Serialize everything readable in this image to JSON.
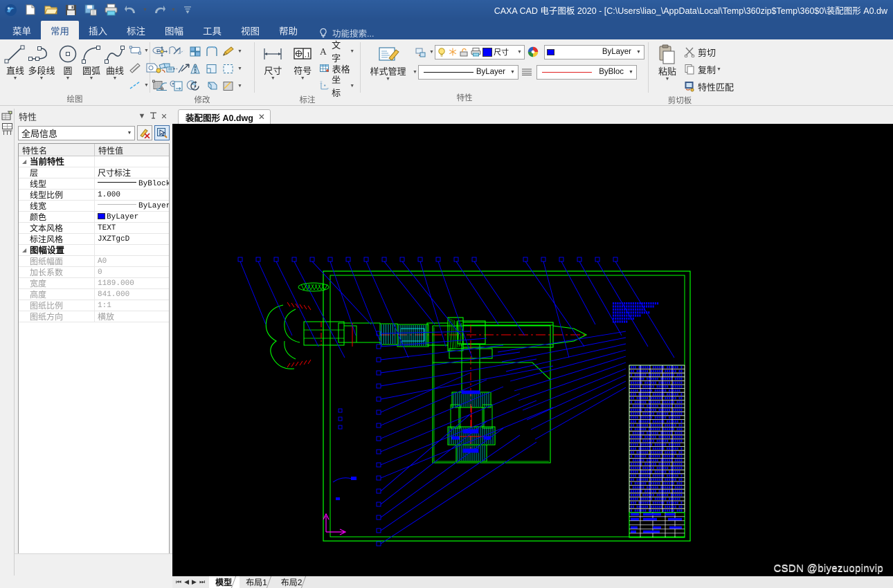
{
  "window": {
    "title": "CAXA CAD 电子图板 2020 - [C:\\Users\\liao_\\AppData\\Local\\Temp\\360zip$Temp\\360$0\\装配图形 A0.dw"
  },
  "quick_access": [
    {
      "name": "app-logo-icon",
      "label": "CAXA"
    },
    {
      "name": "new-file-icon",
      "label": "新建"
    },
    {
      "name": "open-file-icon",
      "label": "打开"
    },
    {
      "name": "save-icon",
      "label": "保存"
    },
    {
      "name": "save-as-icon",
      "label": "另存为"
    },
    {
      "name": "print-icon",
      "label": "打印"
    },
    {
      "name": "undo-icon",
      "label": "撤销"
    },
    {
      "name": "undo-dropdown-icon",
      "label": "撤销列表"
    },
    {
      "name": "redo-icon",
      "label": "重做"
    },
    {
      "name": "redo-dropdown-icon",
      "label": "重做列表"
    },
    {
      "name": "customize-qat-icon",
      "label": "自定义快速访问工具栏"
    }
  ],
  "ribbon": {
    "tabs": [
      {
        "label": "菜单",
        "active": false
      },
      {
        "label": "常用",
        "active": true
      },
      {
        "label": "插入",
        "active": false
      },
      {
        "label": "标注",
        "active": false
      },
      {
        "label": "图幅",
        "active": false
      },
      {
        "label": "工具",
        "active": false
      },
      {
        "label": "视图",
        "active": false
      },
      {
        "label": "帮助",
        "active": false
      }
    ],
    "search_placeholder": "功能搜索...",
    "groups": [
      {
        "title": "绘图",
        "big_buttons": [
          {
            "label": "直线",
            "icon": "line-icon"
          },
          {
            "label": "多段线",
            "icon": "polyline-icon"
          },
          {
            "label": "圆",
            "icon": "circle-icon"
          },
          {
            "label": "圆弧",
            "icon": "arc-icon"
          },
          {
            "label": "曲线",
            "icon": "spline-icon"
          }
        ],
        "small_buttons": [
          {
            "icon": "rectangle-icon",
            "caret": true
          },
          {
            "icon": "ellipse-icon",
            "caret": false
          },
          {
            "icon": "polygon-curve-icon",
            "caret": false
          },
          {
            "icon": "point-icon",
            "caret": false
          },
          {
            "icon": "hatch-icon",
            "caret": false
          },
          {
            "icon": "section-icon",
            "caret": false
          },
          {
            "icon": "local-enlarge-icon",
            "caret": false
          },
          {
            "icon": "arrow-icon",
            "caret": false
          },
          {
            "icon": "centerline-icon",
            "caret": true
          },
          {
            "icon": "mesh-fill-icon",
            "caret": false
          },
          {
            "icon": "gear-profile-icon",
            "caret": false
          },
          {
            "icon": "pie-hatch-icon",
            "caret": false
          }
        ]
      },
      {
        "title": "修改",
        "small_buttons": [
          {
            "icon": "move-icon",
            "caret": false
          },
          {
            "icon": "trim-icon",
            "caret": false
          },
          {
            "icon": "array-icon",
            "caret": false
          },
          {
            "icon": "fillet-icon",
            "caret": false
          },
          {
            "icon": "pencil-edit-icon",
            "caret": true
          },
          {
            "icon": "copy-move-icon",
            "caret": false
          },
          {
            "icon": "extend-icon",
            "caret": false
          },
          {
            "icon": "mirror-icon",
            "caret": false
          },
          {
            "icon": "chamfer-icon",
            "caret": false
          },
          {
            "icon": "offset-icon",
            "caret": true
          },
          {
            "icon": "stretch-icon",
            "caret": false
          },
          {
            "icon": "break-icon",
            "caret": false
          },
          {
            "icon": "rotate-icon",
            "caret": false
          },
          {
            "icon": "scale-icon",
            "caret": false
          },
          {
            "icon": "explode-icon",
            "caret": true
          }
        ]
      },
      {
        "title": "标注",
        "big_buttons": [
          {
            "label": "尺寸",
            "icon": "dimension-icon"
          },
          {
            "label": "符号",
            "icon": "symbol-icon"
          }
        ],
        "text_buttons": [
          {
            "label": "文字",
            "icon": "text-icon",
            "caret": true
          },
          {
            "label": "表格",
            "icon": "table-icon",
            "caret": false
          },
          {
            "label": "坐标",
            "icon": "coordinate-icon",
            "caret": true
          }
        ]
      },
      {
        "title": "特性",
        "big_buttons": [
          {
            "label": "样式管理",
            "icon": "style-manager-icon"
          }
        ],
        "small_buttons": [
          {
            "icon": "layer-transfer-icon",
            "caret": true
          },
          {
            "icon": "linetype-list-icon",
            "caret": true
          }
        ],
        "layer_toolbar": {
          "caret_left": true,
          "icons": [
            "lightbulb-icon",
            "freeze-icon",
            "lock-icon",
            "print-layer-icon",
            "color-box-icon",
            "layer-name-icon"
          ],
          "caret_right": true
        },
        "color_combo": {
          "label": "ByLayer",
          "swatch": "#0000ff",
          "icon": "color-wheel-icon"
        },
        "linetype_combo": {
          "label": "ByLayer",
          "style": "solid-black"
        },
        "lineweight_combo": {
          "label": "ByBloc",
          "style": "solid-red",
          "icon": "lineweight-icon"
        }
      },
      {
        "title": "剪切板",
        "big_buttons": [
          {
            "label": "粘贴",
            "icon": "paste-icon"
          }
        ],
        "text_buttons": [
          {
            "label": "剪切",
            "icon": "cut-icon",
            "caret": false
          },
          {
            "label": "复制",
            "icon": "copy-icon",
            "caret": true
          },
          {
            "label": "特性匹配",
            "icon": "match-properties-icon",
            "caret": false
          }
        ]
      }
    ]
  },
  "left_panel": {
    "title": "特性",
    "header_buttons": [
      {
        "name": "panel-menu-icon",
        "glyph": "▼"
      },
      {
        "name": "pin-icon",
        "glyph": "⊥"
      },
      {
        "name": "close-icon",
        "glyph": "✕"
      }
    ],
    "scope_combo": "全局信息",
    "toolbar_buttons": [
      {
        "name": "clear-properties-button",
        "label": "清除"
      },
      {
        "name": "pick-properties-button",
        "label": "拾取",
        "selected": true
      }
    ],
    "vertical_tabs": [
      {
        "name": "vtab-properties",
        "label": "特性"
      },
      {
        "name": "vtab-library",
        "label": "图册"
      }
    ],
    "columns": [
      "特性名",
      "特性值"
    ],
    "rows": [
      {
        "kind": "group",
        "name": "当前特性"
      },
      {
        "kind": "row",
        "name": "层",
        "value": "尺寸标注",
        "value_kind": "cjk"
      },
      {
        "kind": "row",
        "name": "线型",
        "value": "ByBlock",
        "value_kind": "linetype-black"
      },
      {
        "kind": "row",
        "name": "线型比例",
        "value": "1.000",
        "value_kind": "mono"
      },
      {
        "kind": "row",
        "name": "线宽",
        "value": "ByLayer",
        "value_kind": "linetype-gray"
      },
      {
        "kind": "row",
        "name": "颜色",
        "value": "ByLayer",
        "value_kind": "color-swatch",
        "swatch": "#0000ff"
      },
      {
        "kind": "row",
        "name": "文本风格",
        "value": "TEXT",
        "value_kind": "mono"
      },
      {
        "kind": "row",
        "name": "标注风格",
        "value": "JXZTgcD",
        "value_kind": "mono"
      },
      {
        "kind": "group",
        "name": "图幅设置"
      },
      {
        "kind": "row",
        "name": "图纸幅面",
        "value": "A0",
        "value_kind": "mono",
        "dim": true
      },
      {
        "kind": "row",
        "name": "加长系数",
        "value": "0",
        "value_kind": "mono",
        "dim": true
      },
      {
        "kind": "row",
        "name": "宽度",
        "value": "1189.000",
        "value_kind": "mono",
        "dim": true
      },
      {
        "kind": "row",
        "name": "高度",
        "value": "841.000",
        "value_kind": "mono",
        "dim": true
      },
      {
        "kind": "row",
        "name": "图纸比例",
        "value": "1:1",
        "value_kind": "mono",
        "dim": true
      },
      {
        "kind": "row",
        "name": "图纸方向",
        "value": "横放",
        "value_kind": "cjk",
        "dim": true
      }
    ]
  },
  "document": {
    "tab_label": "装配图形 A0.dwg",
    "tab_close": "✕"
  },
  "sheet_bar": {
    "nav": [
      {
        "name": "first-sheet-button",
        "glyph": "⏮"
      },
      {
        "name": "prev-sheet-button",
        "glyph": "◀"
      },
      {
        "name": "next-sheet-button",
        "glyph": "▶"
      },
      {
        "name": "last-sheet-button",
        "glyph": "⏭"
      }
    ],
    "tabs": [
      {
        "label": "模型",
        "active": true
      },
      {
        "label": "布局1",
        "active": false
      },
      {
        "label": "布局2",
        "active": false
      }
    ]
  },
  "watermark": "CSDN @biyezuopinvip",
  "canvas": {
    "background": "#000000",
    "colors": {
      "frame": "#00ff00",
      "geometry": "#00ff00",
      "hatch": "#00ffff",
      "leader": "#0000ff",
      "centerline": "#ff0000",
      "ucs": "#ff00ff",
      "table_rule": "#ffffff"
    },
    "drawing_name": "装配图形 A0",
    "sheet_format": "A0",
    "balloon_count_top": 20,
    "balloon_count_left": 17,
    "bom_rows": 38,
    "note_block_lines": 4,
    "ucs_label": "坐标系"
  }
}
